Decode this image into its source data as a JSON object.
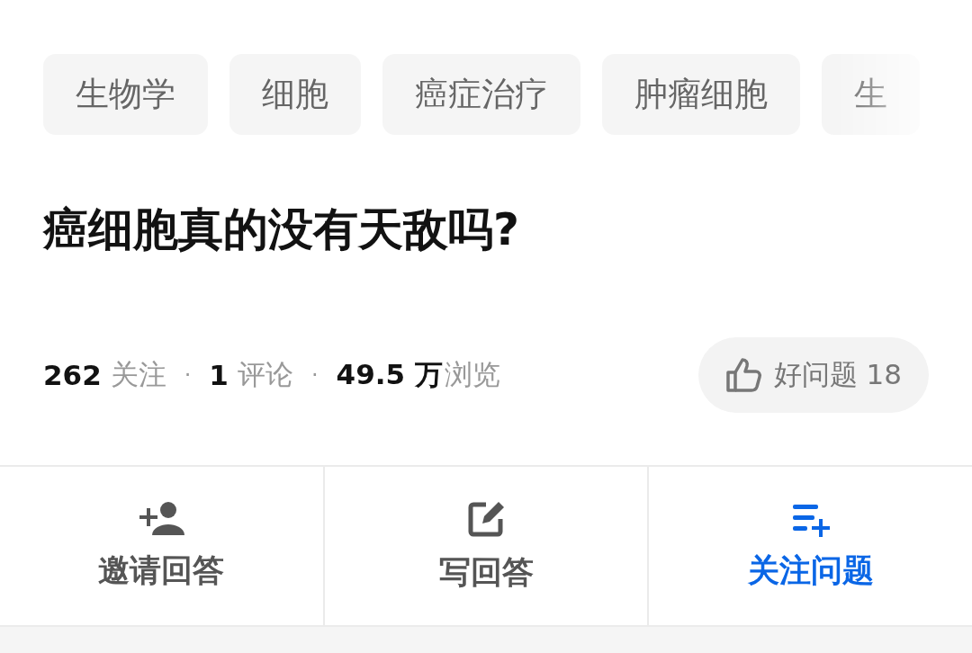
{
  "tags": [
    "生物学",
    "细胞",
    "癌症治疗",
    "肿瘤细胞",
    "生"
  ],
  "question": {
    "title": "癌细胞真的没有天敌吗?"
  },
  "stats": [
    {
      "value": "262",
      "label": "关注"
    },
    {
      "separator": "·",
      "value": "1",
      "label": "评论"
    },
    {
      "separator": "·",
      "value": "49.5 万",
      "label": "浏览"
    }
  ],
  "good_question": {
    "label": "好问题 18"
  },
  "actions": [
    {
      "kind": "invite",
      "label": "邀请回答",
      "accent": false
    },
    {
      "kind": "write",
      "label": "写回答",
      "accent": false
    },
    {
      "kind": "follow",
      "label": "关注问题",
      "accent": true
    }
  ]
}
